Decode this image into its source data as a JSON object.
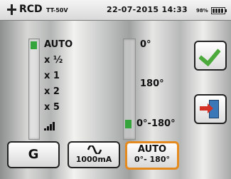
{
  "header": {
    "logo": "RCD",
    "model": "TT-50V",
    "datetime": "22-07-2015 14:33",
    "battery_percent": "98%"
  },
  "multiplier": {
    "options": [
      "AUTO",
      "x ½",
      "x 1",
      "x 2",
      "x 5"
    ],
    "selected": "AUTO"
  },
  "angle": {
    "options": [
      "0°",
      "180°",
      "0°-180°"
    ],
    "selected": "0°-180°"
  },
  "side_buttons": {
    "confirm_icon": "check-icon",
    "exit_icon": "exit-door-icon"
  },
  "bottom_buttons": {
    "g_label": "G",
    "current_label": "1000mA",
    "auto_label": "AUTO",
    "auto_sub": "0°- 180°"
  },
  "colors": {
    "selection": "#35a43a",
    "active_border": "#e58a1e"
  }
}
